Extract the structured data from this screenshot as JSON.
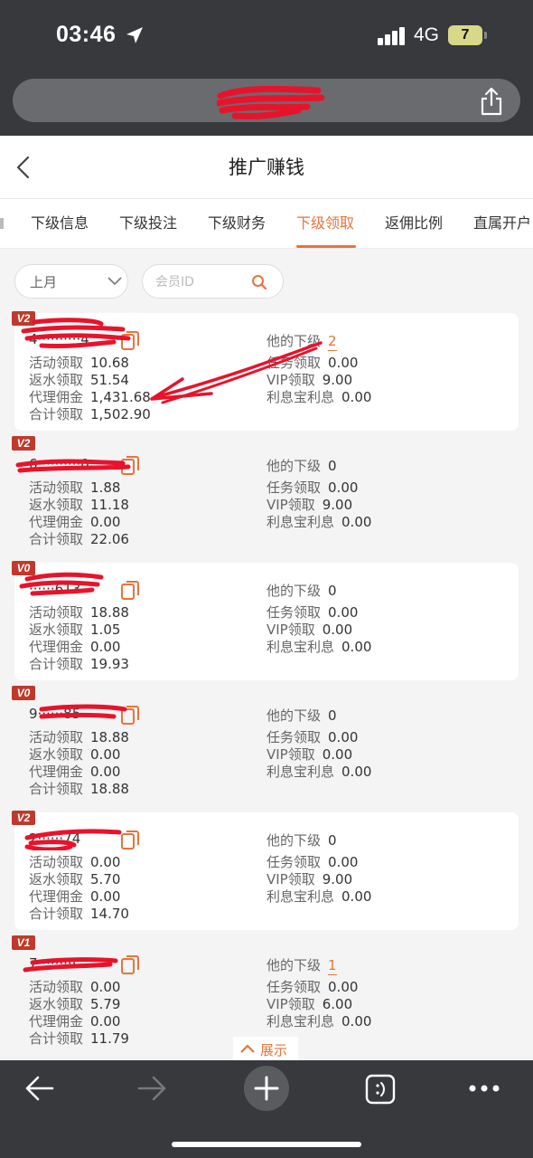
{
  "status_bar": {
    "time": "03:46",
    "network": "4G",
    "battery": "7"
  },
  "header": {
    "title": "推广赚钱"
  },
  "tabs": [
    {
      "label": "下级信息",
      "active": false
    },
    {
      "label": "下级投注",
      "active": false
    },
    {
      "label": "下级财务",
      "active": false
    },
    {
      "label": "下级领取",
      "active": true
    },
    {
      "label": "返佣比例",
      "active": false
    },
    {
      "label": "直属开户",
      "active": false
    }
  ],
  "filters": {
    "month": "上月",
    "member_placeholder": "会员ID"
  },
  "labels": {
    "activity": "活动领取",
    "rebate": "返水领取",
    "agent": "代理佣金",
    "total": "合计领取",
    "subordinates": "他的下级",
    "task": "任务领取",
    "vip": "VIP领取",
    "interest": "利息宝利息"
  },
  "members": [
    {
      "level": "V2",
      "id": "4··········4",
      "activity": "10.68",
      "rebate": "51.54",
      "agent": "1,431.68",
      "total": "1,502.90",
      "subordinates": "2",
      "task": "0.00",
      "vip": "9.00",
      "interest": "0.00"
    },
    {
      "level": "V2",
      "id": "6··········0",
      "activity": "1.88",
      "rebate": "11.18",
      "agent": "0.00",
      "total": "22.06",
      "subordinates": "0",
      "task": "0.00",
      "vip": "9.00",
      "interest": "0.00"
    },
    {
      "level": "V0",
      "id": "······613",
      "activity": "18.88",
      "rebate": "1.05",
      "agent": "0.00",
      "total": "19.93",
      "subordinates": "0",
      "task": "0.00",
      "vip": "0.00",
      "interest": "0.00"
    },
    {
      "level": "V0",
      "id": "9······85",
      "activity": "18.88",
      "rebate": "0.00",
      "agent": "0.00",
      "total": "18.88",
      "subordinates": "0",
      "task": "0.00",
      "vip": "0.00",
      "interest": "0.00"
    },
    {
      "level": "V2",
      "id": "2······74",
      "activity": "0.00",
      "rebate": "5.70",
      "agent": "0.00",
      "total": "14.70",
      "subordinates": "0",
      "task": "0.00",
      "vip": "9.00",
      "interest": "0.00"
    },
    {
      "level": "V1",
      "id": "7·········",
      "activity": "0.00",
      "rebate": "5.79",
      "agent": "0.00",
      "total": "11.79",
      "subordinates": "1",
      "task": "0.00",
      "vip": "6.00",
      "interest": "0.00"
    }
  ],
  "expand_label": "展示",
  "colors": {
    "accent": "#e9733a",
    "badge": "#c0392b",
    "redaction": "#e8132b",
    "chrome": "#38393d"
  }
}
